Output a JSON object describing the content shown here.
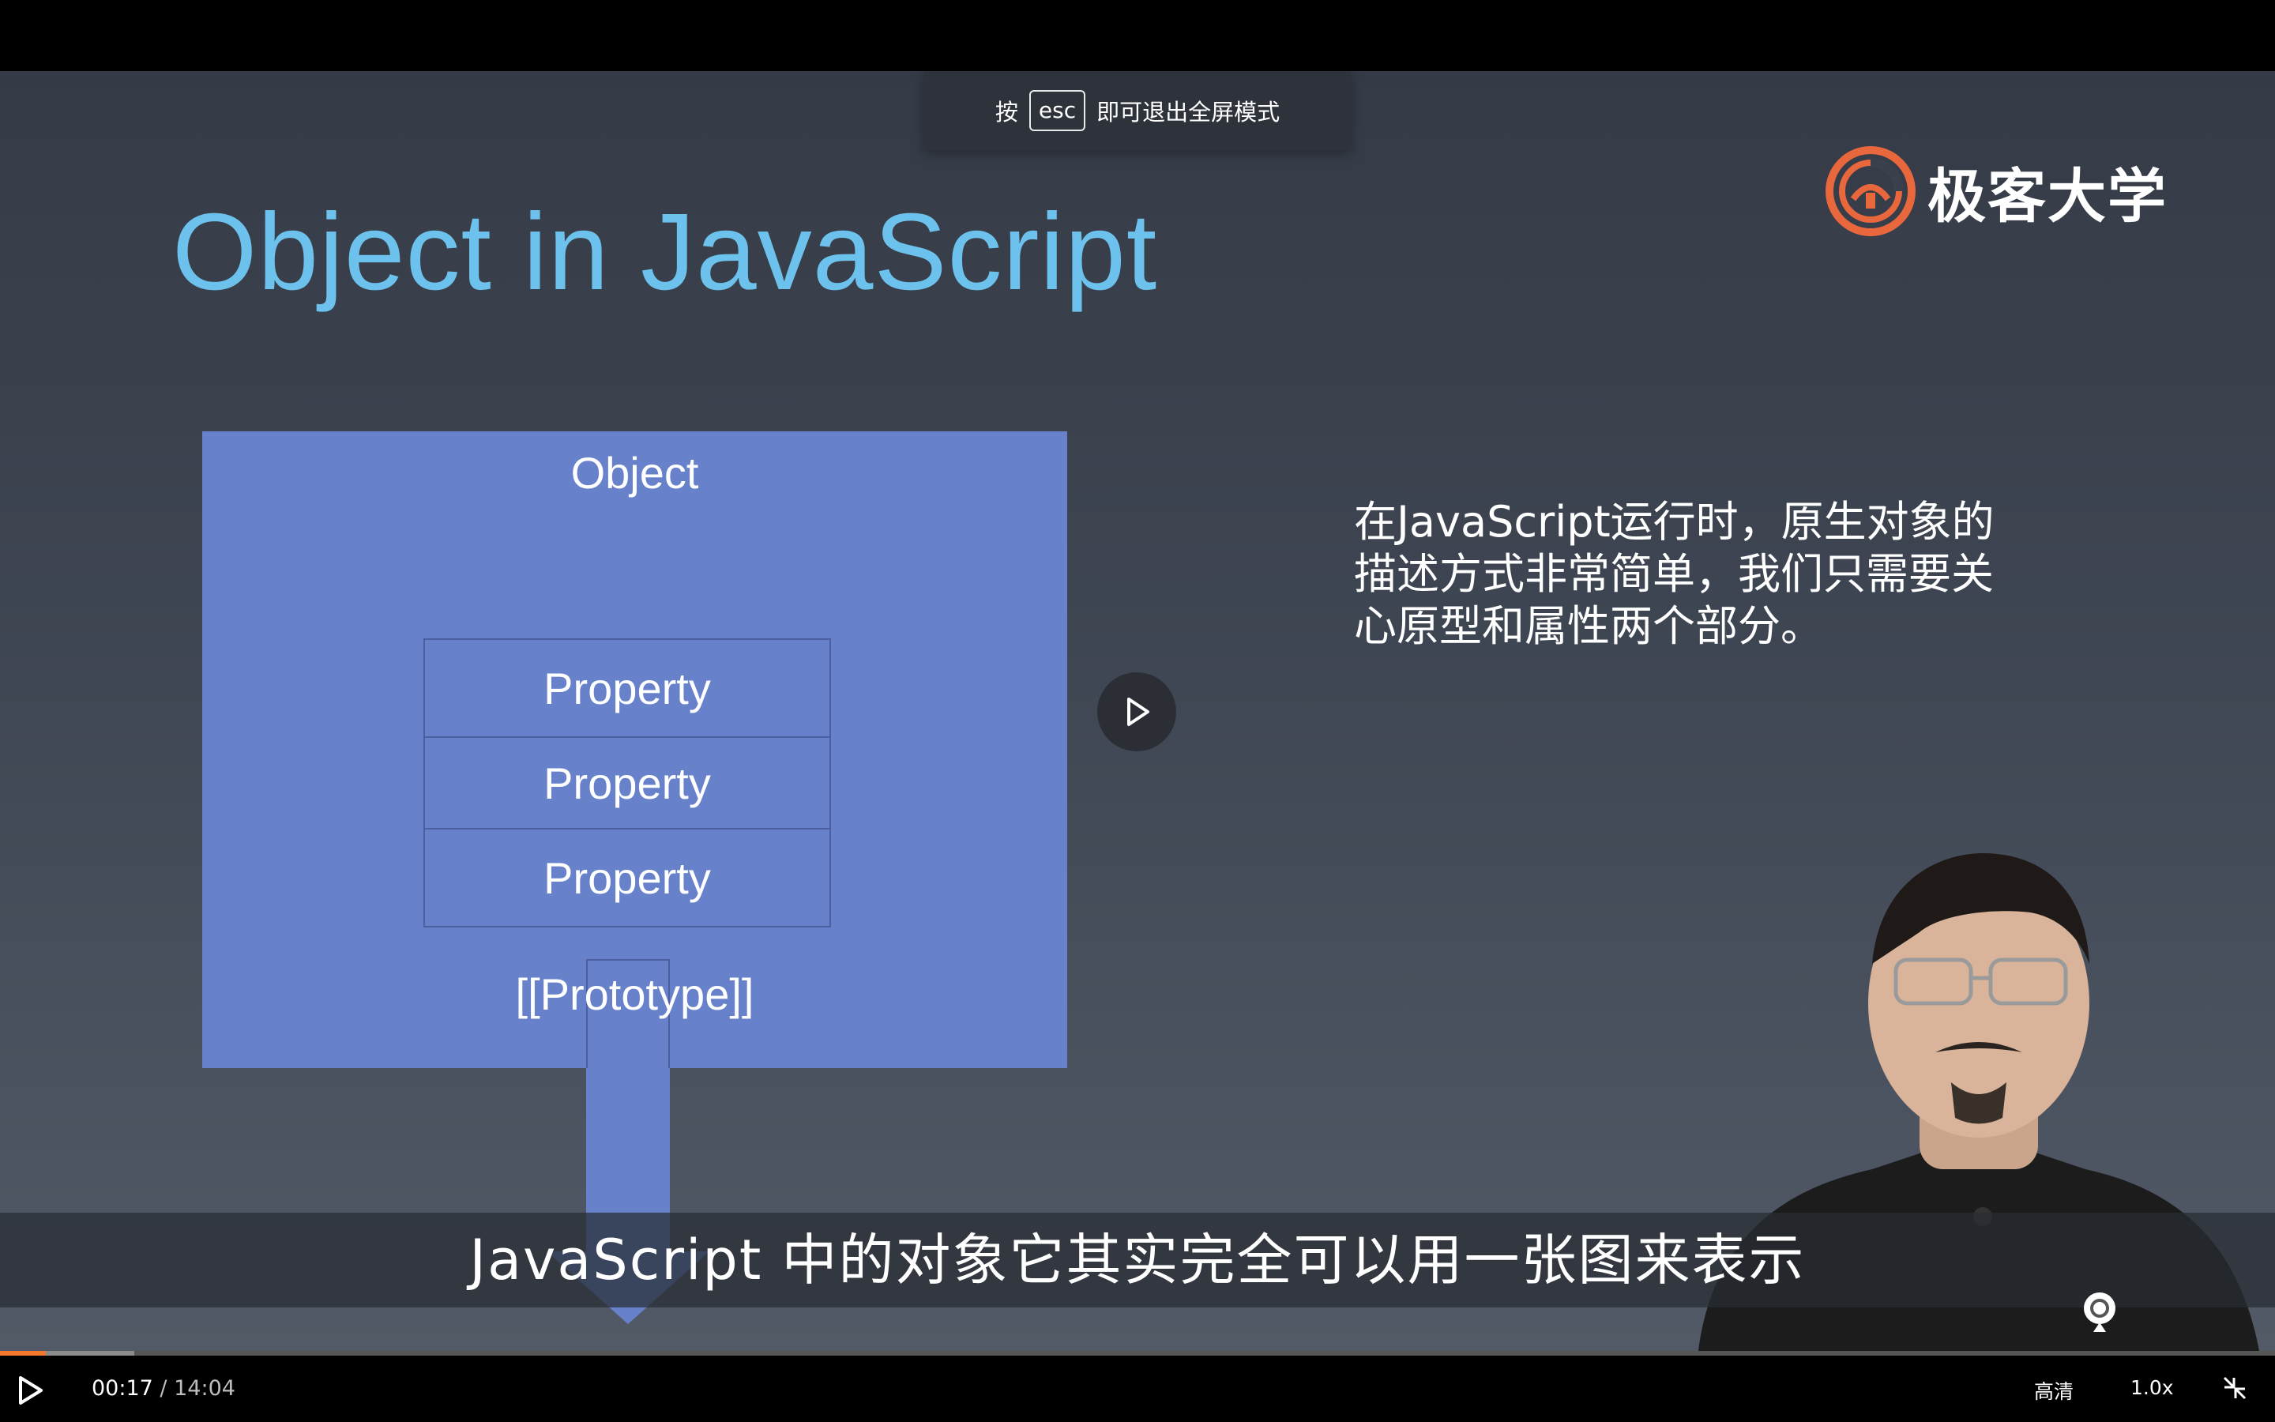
{
  "esc_hint": {
    "prefix": "按",
    "key": "esc",
    "suffix": "即可退出全屏模式"
  },
  "logo": {
    "text": "极客大学",
    "brand_color": "#e9673c"
  },
  "slide": {
    "title": "Object in JavaScript",
    "title_color": "#6cc2ec",
    "diagram": {
      "object_label": "Object",
      "properties": [
        "Property",
        "Property",
        "Property"
      ],
      "prototype_label": "[[Prototype]]",
      "box_color": "#6781cb"
    },
    "description": "在JavaScript运行时，原生对象的描述方式非常简单，我们只需要关心原型和属性两个部分。"
  },
  "subtitle": "JavaScript 中的对象它其实完全可以用一张图来表示",
  "player": {
    "current_time": "00:17",
    "separator": "/",
    "duration": "14:04",
    "quality": "高清",
    "speed": "1.0x",
    "progress_color": "#f3782c"
  },
  "icons": {
    "center_play": "play-icon",
    "bottom_play": "play-icon",
    "exit_fullscreen": "exit-fullscreen-icon",
    "watermark": "geekbang-logo-icon"
  }
}
